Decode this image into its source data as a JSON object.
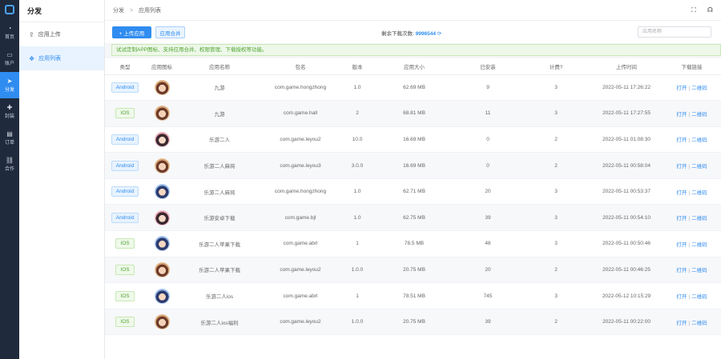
{
  "nav": {
    "items": [
      {
        "icon": "dashboard-icon",
        "glyph": "◔",
        "label": "首页"
      },
      {
        "icon": "folder-icon",
        "glyph": "▭",
        "label": "账户"
      },
      {
        "icon": "send-icon",
        "glyph": "➤",
        "label": "分发"
      },
      {
        "icon": "plus-icon",
        "glyph": "✚",
        "label": "封装"
      },
      {
        "icon": "order-icon",
        "glyph": "▤",
        "label": "订单"
      },
      {
        "icon": "link-icon",
        "glyph": "⛓",
        "label": "合作"
      }
    ]
  },
  "sidebar": {
    "title": "分发",
    "items": [
      {
        "icon": "upload-icon",
        "glyph": "⇪",
        "label": "应用上传"
      },
      {
        "icon": "app-list-icon",
        "glyph": "❖",
        "label": "应用列表"
      }
    ]
  },
  "header": {
    "crumb_root": "分发",
    "crumb_current": "应用列表",
    "fullscreen_glyph": "⛶",
    "support_glyph": "☊"
  },
  "toolbar": {
    "upload_label": "+ 上传应用",
    "merge_label": "应用合并",
    "downloads_label": "剩余下载次数:",
    "downloads_value": "9996544",
    "search_placeholder": "应用名称"
  },
  "notice": "试试定制APP图标、支持应用合并、权限管理、下载授权等功能。",
  "table": {
    "headers": [
      "类型",
      "应用图标",
      "应用名称",
      "包名",
      "版本",
      "应用大小",
      "已安装",
      "计费?",
      "上传时间",
      "下载链接"
    ],
    "rows": [
      {
        "type": "Android",
        "avatar": "a",
        "name": "九游",
        "package": "com.game.hongzhong",
        "version": "1.0",
        "size": "62.69 MB",
        "installed": "9",
        "billing": "3",
        "time": "2022-05-11 17:26:22"
      },
      {
        "type": "IOS",
        "avatar": "a",
        "name": "九游",
        "package": "com.game.hall",
        "version": "2",
        "size": "68.81 MB",
        "installed": "11",
        "billing": "3",
        "time": "2022-05-11 17:27:55"
      },
      {
        "type": "Android",
        "avatar": "c",
        "name": "乐游二人",
        "package": "com.game.leyou2",
        "version": "10.0",
        "size": "16.69 MB",
        "installed": "0",
        "billing": "2",
        "time": "2022-05-11 01:08:30"
      },
      {
        "type": "Android",
        "avatar": "a",
        "name": "乐游二人麻将",
        "package": "com.game.leyou3",
        "version": "3.0.0",
        "size": "16.69 MB",
        "installed": "0",
        "billing": "2",
        "time": "2022-05-11 00:58:04"
      },
      {
        "type": "Android",
        "avatar": "b",
        "name": "乐游二人麻将",
        "package": "com.game.hongzhong",
        "version": "1.0",
        "size": "62.71 MB",
        "installed": "20",
        "billing": "3",
        "time": "2022-05-11 00:53:37"
      },
      {
        "type": "Android",
        "avatar": "c",
        "name": "乐游安卓下载",
        "package": "com.game.bjl",
        "version": "1.0",
        "size": "62.75 MB",
        "installed": "39",
        "billing": "3",
        "time": "2022-05-11 00:54:10"
      },
      {
        "type": "IOS",
        "avatar": "b",
        "name": "乐游二人苹果下载",
        "package": "com.game.abrl",
        "version": "1",
        "size": "78.5 MB",
        "installed": "48",
        "billing": "3",
        "time": "2022-05-11 00:50:46"
      },
      {
        "type": "IOS",
        "avatar": "a",
        "name": "乐游二人苹果下载",
        "package": "com.game.leyou2",
        "version": "1.0.0",
        "size": "20.75 MB",
        "installed": "20",
        "billing": "2",
        "time": "2022-05-11 00:46:25"
      },
      {
        "type": "IOS",
        "avatar": "b",
        "name": "乐游二人ios",
        "package": "com.game.abrl",
        "version": "1",
        "size": "78.51 MB",
        "installed": "745",
        "billing": "3",
        "time": "2022-05-12 10:15:29"
      },
      {
        "type": "IOS",
        "avatar": "a",
        "name": "乐游二人ios福利",
        "package": "com.game.leyou2",
        "version": "1.0.0",
        "size": "20.75 MB",
        "installed": "39",
        "billing": "2",
        "time": "2022-05-11 00:22:00"
      }
    ],
    "open_label": "打开",
    "qr_label": "二维码"
  },
  "colors": {
    "accent": "#2f8cf0",
    "nav_bg": "#1f2a3c",
    "success": "#52a535"
  }
}
